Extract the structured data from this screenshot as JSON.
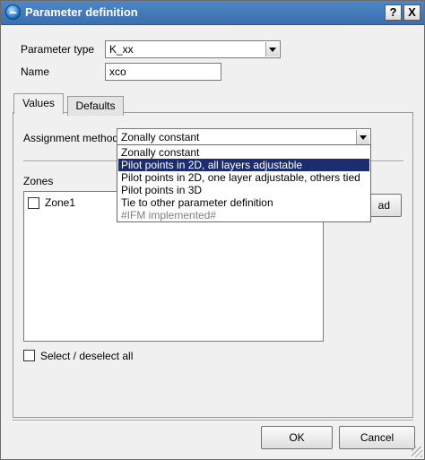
{
  "window": {
    "title": "Parameter definition",
    "help_label": "?",
    "close_label": "X"
  },
  "form": {
    "parameter_type_label": "Parameter type",
    "parameter_type_value": "K_xx",
    "name_label": "Name",
    "name_value": "xco"
  },
  "tabs": [
    {
      "label": "Values",
      "active": true
    },
    {
      "label": "Defaults",
      "active": false
    }
  ],
  "values_tab": {
    "assignment_method_label": "Assignment method",
    "assignment_method_value": "Zonally constant",
    "assignment_options": [
      {
        "label": "Zonally constant",
        "selected": false,
        "enabled": true
      },
      {
        "label": "Pilot points in 2D, all layers adjustable",
        "selected": true,
        "enabled": true
      },
      {
        "label": "Pilot points in 2D, one layer adjustable, others tied",
        "selected": false,
        "enabled": true
      },
      {
        "label": "Pilot points in 3D",
        "selected": false,
        "enabled": true
      },
      {
        "label": "Tie to other parameter definition",
        "selected": false,
        "enabled": true
      },
      {
        "label": "#IFM implemented#",
        "selected": false,
        "enabled": false
      }
    ],
    "zones_label": "Zones",
    "zones": [
      {
        "label": "Zone1",
        "checked": false
      }
    ],
    "side_button_label": "ad",
    "select_all_label": "Select / deselect all"
  },
  "footer": {
    "ok_label": "OK",
    "cancel_label": "Cancel"
  },
  "colors": {
    "title_bar": "#3a6fb0",
    "selection": "#1b2d6e",
    "dialog_bg": "#f0f0f0"
  }
}
